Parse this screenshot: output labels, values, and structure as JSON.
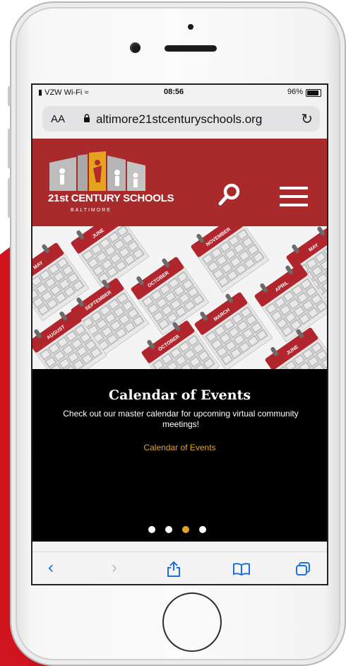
{
  "status_bar": {
    "carrier": "VZW Wi-Fi",
    "time": "08:56",
    "battery": "96%"
  },
  "browser": {
    "text_size_button": "AA",
    "url": "altimore21stcenturyschools.org"
  },
  "site": {
    "logo_title": "21st CENTURY SCHOOLS",
    "logo_subtitle": "BALTIMORE"
  },
  "hero": {
    "month_labels": [
      "MAY",
      "JUNE",
      "NOVEMBER",
      "MAY",
      "OCTOBER",
      "APRIL",
      "SEPTEMBER",
      "MARCH",
      "AUGUST",
      "OCTOBER",
      "JUNE"
    ],
    "title": "Calendar of Events",
    "description": "Check out our master calendar for upcoming virtual community meetings!",
    "link_label": "Calendar of Events",
    "slide_count": 4,
    "active_slide": 3
  },
  "colors": {
    "header_red": "#a82a2a",
    "accent_gold": "#e5a420",
    "ios_blue": "#1b6ee6"
  },
  "icons": {
    "search": "search-icon",
    "menu": "hamburger-menu-icon",
    "lock": "lock-icon",
    "reload": "reload-icon",
    "back": "chevron-left-icon",
    "forward": "chevron-right-icon",
    "share": "share-icon",
    "bookmarks": "book-icon",
    "tabs": "tabs-icon"
  }
}
